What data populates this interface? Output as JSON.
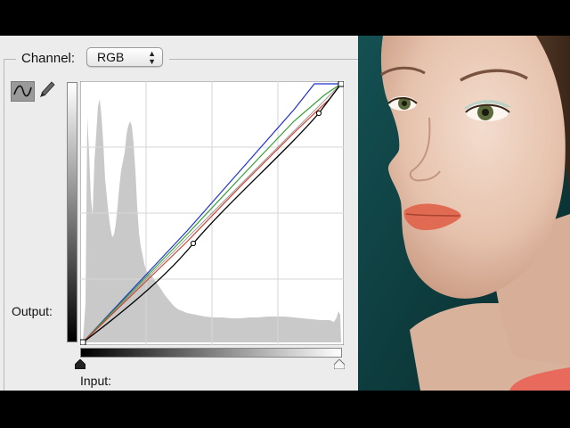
{
  "curves_panel": {
    "channel_label": "Channel:",
    "channel_value": "RGB",
    "output_label": "Output:",
    "input_label": "Input:",
    "tools": [
      "curve-tool-icon",
      "pencil-icon"
    ]
  },
  "curve_colors": {
    "composite": "#000000",
    "red": "#d04030",
    "green": "#30a030",
    "blue": "#2030d0"
  },
  "colors": {
    "panel_bg": "#ececec",
    "photo_bg": "#0d3c3e",
    "histogram": "#c9c9c9"
  }
}
